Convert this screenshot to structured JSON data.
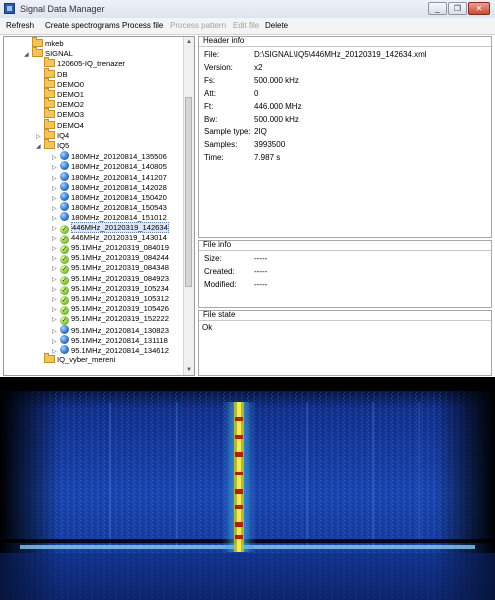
{
  "window": {
    "title": "Signal Data Manager",
    "minimize": "_",
    "maximize": "❐",
    "close": "✕"
  },
  "menu": [
    "Refresh",
    "Create spectrograms",
    "Process file",
    "Process pattern",
    "Edit file",
    "Delete"
  ],
  "menu_disabled": [
    "Process pattern",
    "Edit file"
  ],
  "tree": {
    "folders": [
      "mkeb",
      "SIGNAL",
      "120605-IQ_trenazer",
      "DB",
      "DEMO0",
      "DEMO1",
      "DEMO2",
      "DEMO3",
      "DEMO4",
      "IQ4",
      "IQ5"
    ],
    "files": [
      {
        "name": "180MHz_20120814_135506",
        "icon": "globe-icon"
      },
      {
        "name": "180MHz_20120814_140805",
        "icon": "globe-icon"
      },
      {
        "name": "180MHz_20120814_141207",
        "icon": "globe-icon"
      },
      {
        "name": "180MHz_20120814_142028",
        "icon": "globe-icon"
      },
      {
        "name": "180MHz_20120814_150420",
        "icon": "globe-icon"
      },
      {
        "name": "180MHz_20120814_150543",
        "icon": "globe-icon"
      },
      {
        "name": "180MHz_20120814_151012",
        "icon": "globe-icon"
      },
      {
        "name": "446MHz_20120319_142634",
        "icon": "check-icon"
      },
      {
        "name": "446MHz_20120319_143014",
        "icon": "check-icon"
      },
      {
        "name": "95.1MHz_20120319_084019",
        "icon": "check-icon"
      },
      {
        "name": "95.1MHz_20120319_084244",
        "icon": "check-icon"
      },
      {
        "name": "95.1MHz_20120319_084348",
        "icon": "check-icon"
      },
      {
        "name": "95.1MHz_20120319_084923",
        "icon": "check-icon"
      },
      {
        "name": "95.1MHz_20120319_105234",
        "icon": "check-icon"
      },
      {
        "name": "95.1MHz_20120319_105312",
        "icon": "check-icon"
      },
      {
        "name": "95.1MHz_20120319_105426",
        "icon": "check-icon"
      },
      {
        "name": "95.1MHz_20120319_152222",
        "icon": "check-icon"
      },
      {
        "name": "95.1MHz_20120814_130823",
        "icon": "globe-icon"
      },
      {
        "name": "95.1MHz_20120814_131118",
        "icon": "globe-icon"
      },
      {
        "name": "95.1MHz_20120814_134612",
        "icon": "globe-icon"
      }
    ],
    "trailing_folder": "IQ_vyber_mereni",
    "selected": "446MHz_20120319_142634"
  },
  "header_info": {
    "title": "Header info",
    "rows": [
      {
        "key": "File:",
        "value": "D:\\SIGNAL\\IQ5\\446MHz_20120319_142634.xml"
      },
      {
        "key": "Version:",
        "value": "x2"
      },
      {
        "key": "Fs:",
        "value": "500.000 kHz"
      },
      {
        "key": "Att:",
        "value": "0"
      },
      {
        "key": "Ft:",
        "value": "446.000 MHz"
      },
      {
        "key": "Bw:",
        "value": "500.000 kHz"
      },
      {
        "key": "Sample type:",
        "value": "2IQ"
      },
      {
        "key": "Samples:",
        "value": "3993500"
      },
      {
        "key": "Time:",
        "value": "7.987  s"
      }
    ]
  },
  "file_info": {
    "title": "File info",
    "rows": [
      {
        "key": "Size:",
        "value": "-----"
      },
      {
        "key": "Created:",
        "value": "-----"
      },
      {
        "key": "Modified:",
        "value": "-----"
      }
    ]
  },
  "file_state": {
    "title": "File state",
    "text": "Ok"
  },
  "colors": {
    "accent": "#2a5caa",
    "spectrum_bg": "#0a1a55",
    "signal": "#e9d21a",
    "selection": "#dce8f8"
  }
}
